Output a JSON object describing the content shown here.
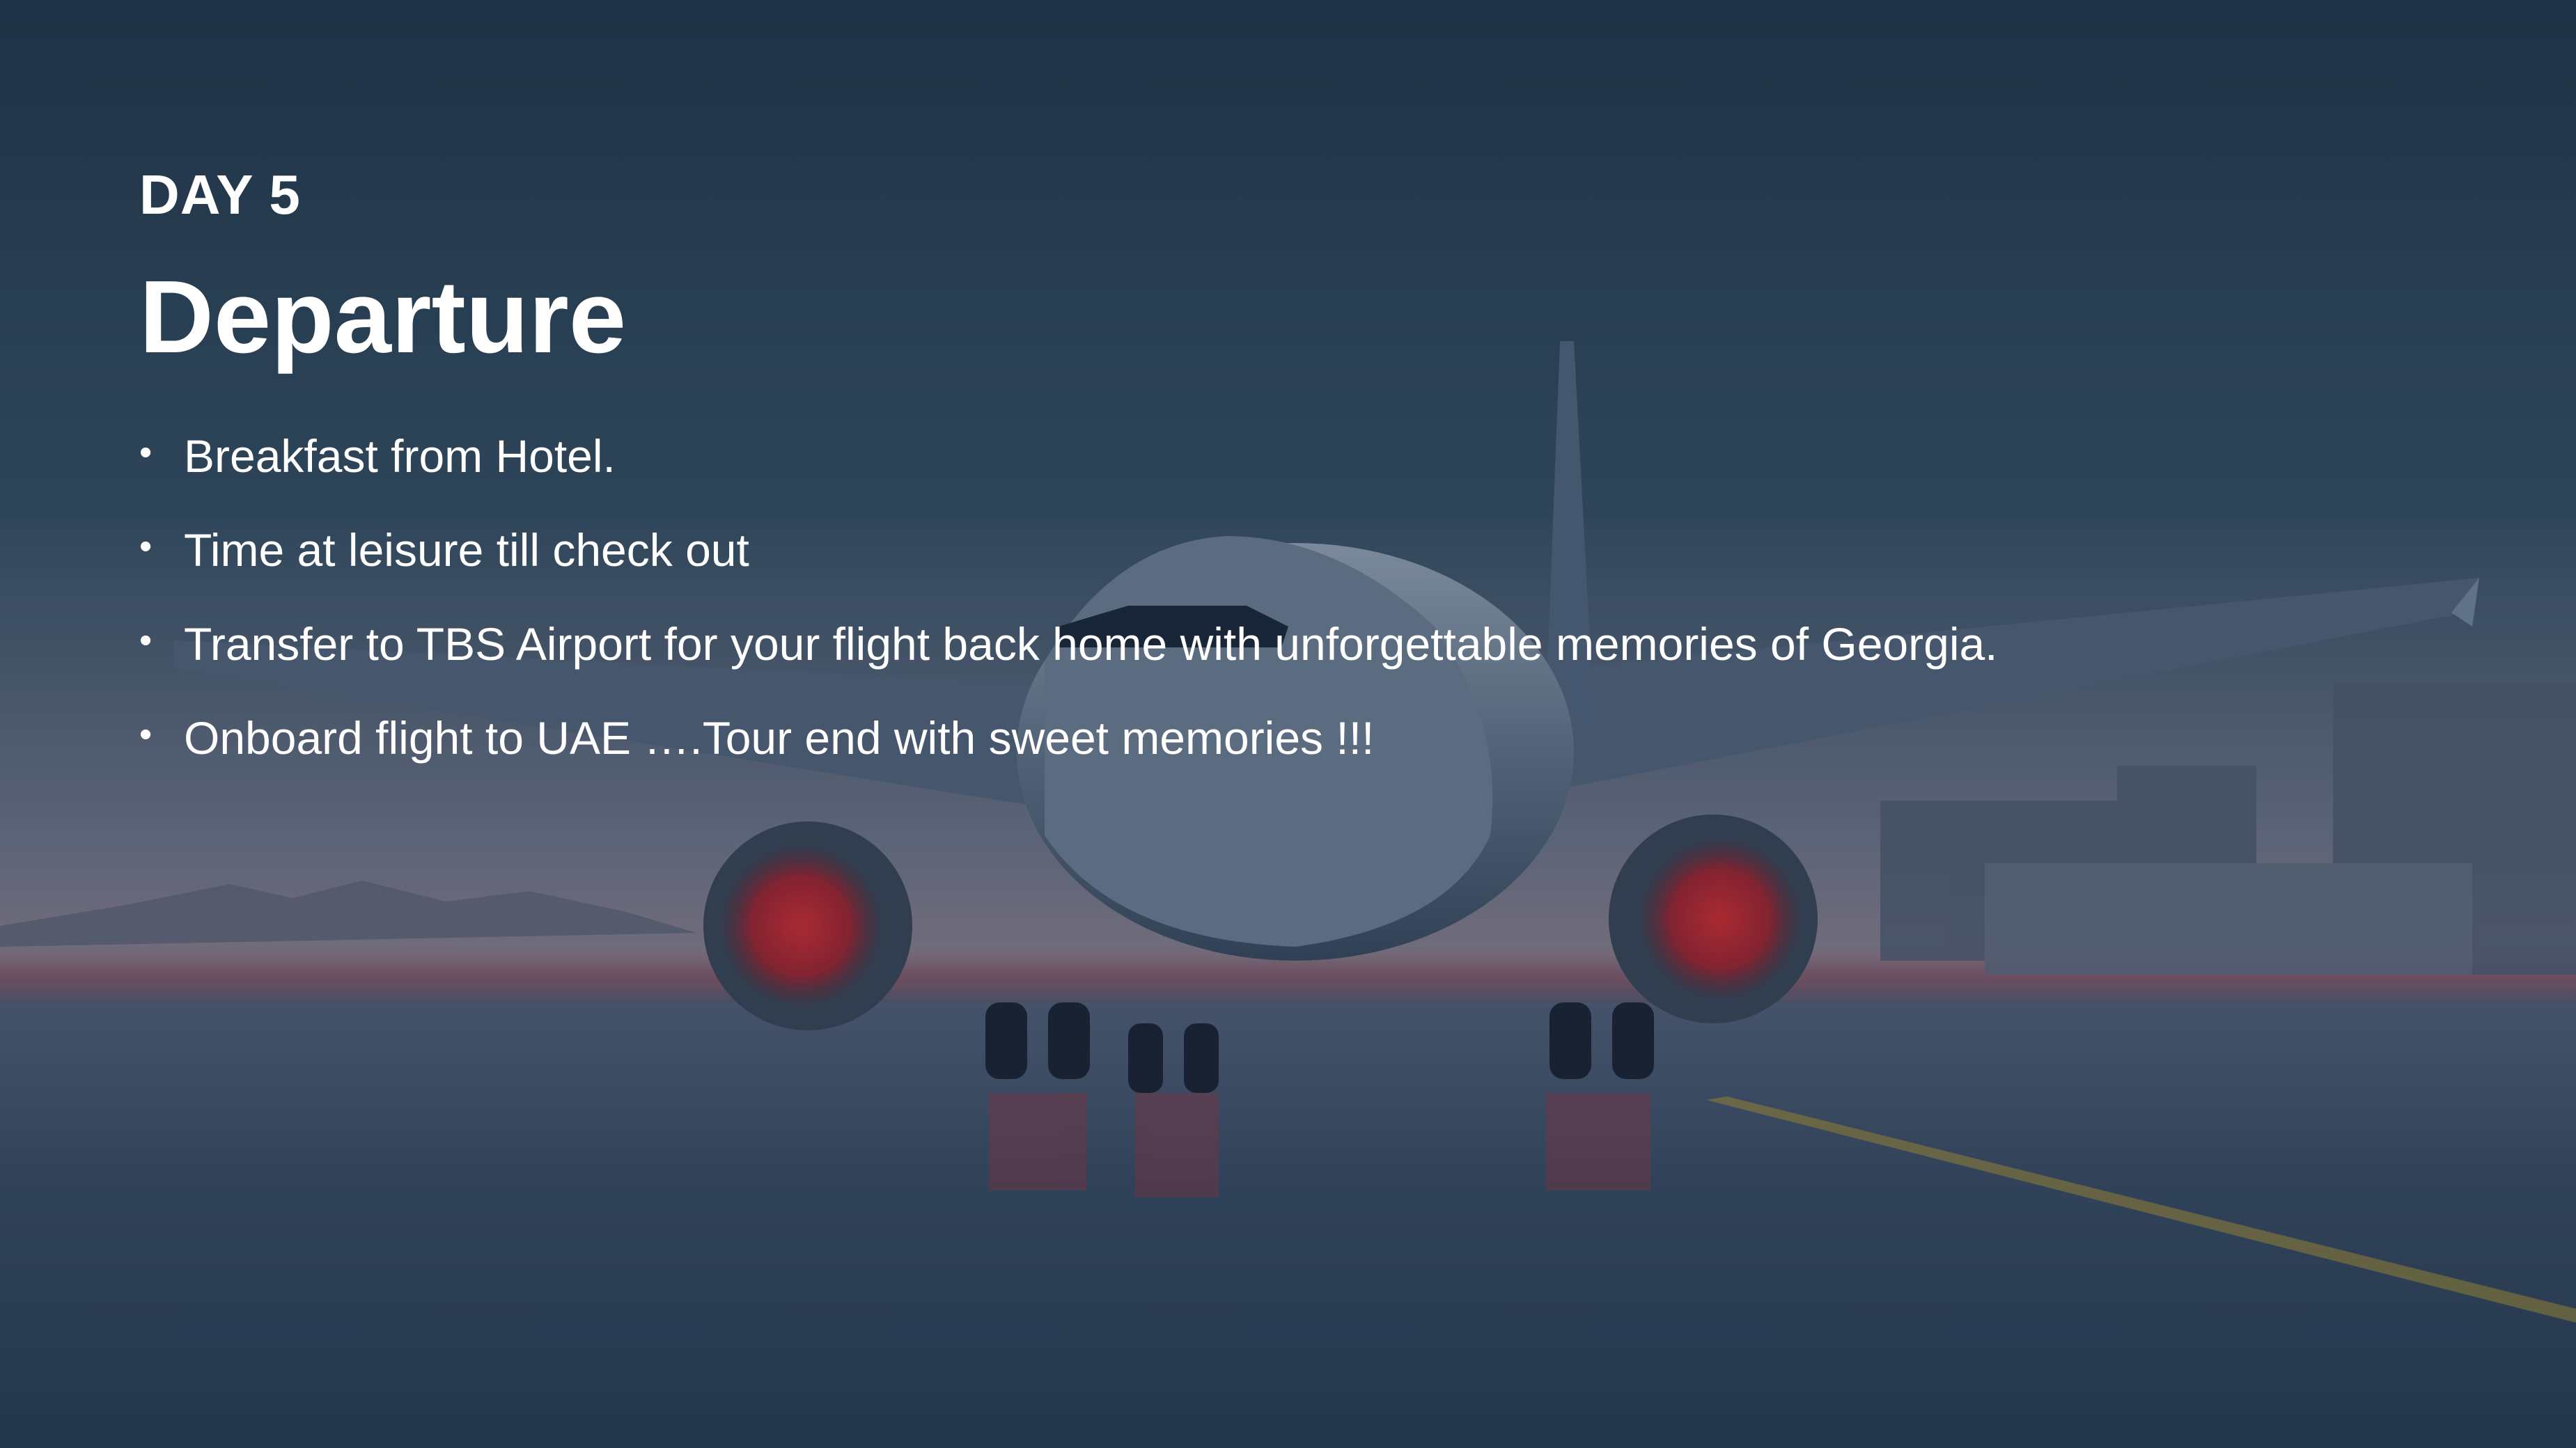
{
  "slide": {
    "day_label": "DAY 5",
    "title": "Departure",
    "bullets": [
      "Breakfast from Hotel.",
      "Time at leisure till check out",
      "Transfer to TBS Airport for your flight back home with unforgettable memories of Georgia.",
      "Onboard flight to UAE ….Tour end with sweet memories !!!"
    ],
    "bullet_symbol": "•"
  },
  "colors": {
    "text": "#ffffff",
    "sky_top": "#2a4256",
    "sky_horizon": "#8a8a9a",
    "runway": "#3a4e62",
    "engine_glow": "#d81e28",
    "taxi_line": "#c8a832"
  },
  "background": {
    "subject": "commercial-airplane-on-wet-runway"
  }
}
